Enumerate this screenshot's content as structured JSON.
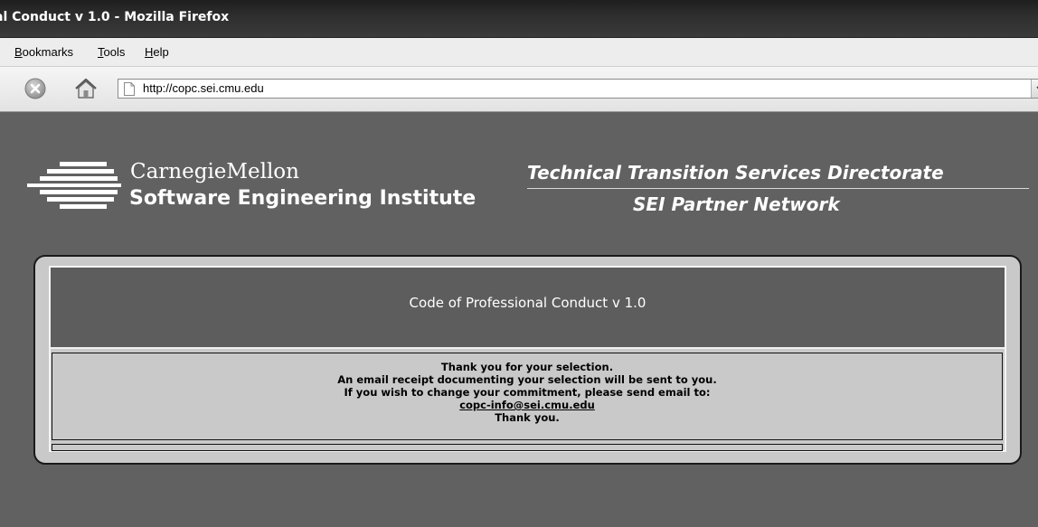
{
  "window": {
    "title": "al Conduct v 1.0 - Mozilla Firefox"
  },
  "menu": {
    "items": [
      {
        "label": "Bookmarks",
        "accel": "B",
        "rest": "ookmarks"
      },
      {
        "label": "Tools",
        "accel": "T",
        "rest": "ools"
      },
      {
        "label": "Help",
        "accel": "H",
        "rest": "elp"
      }
    ]
  },
  "toolbar": {
    "stop_icon": "stop-icon",
    "home_icon": "home-icon",
    "url": "http://copc.sei.cmu.edu"
  },
  "header": {
    "org_line1": "CarnegieMellon",
    "org_line2": "Software Engineering Institute",
    "directorate": "Technical Transition Services Directorate",
    "network": "SEI Partner Network"
  },
  "panel": {
    "heading": "Code of Professional Conduct v 1.0",
    "messages": [
      "Thank you for your selection.",
      "An email receipt documenting your selection will be sent to you.",
      "If you wish to change your commitment, please send email to:"
    ],
    "email": "copc-info@sei.cmu.edu",
    "closing": "Thank you."
  },
  "colors": {
    "page_bg": "#616161",
    "panel_bg": "#c9c9c9",
    "panel_head_bg": "#5d5d5d"
  }
}
